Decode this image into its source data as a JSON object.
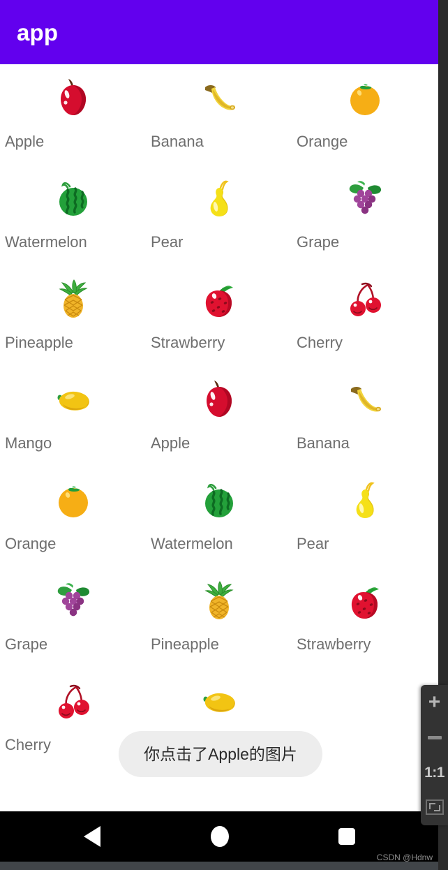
{
  "appbar": {
    "title": "app",
    "background_color": "#6200EE",
    "title_color": "#FFFFFF"
  },
  "grid": {
    "columns": 3,
    "label_color": "#6E6E6E",
    "rows": [
      [
        {
          "label": "Apple",
          "icon": "apple-icon"
        },
        {
          "label": "Banana",
          "icon": "banana-icon"
        },
        {
          "label": "Orange",
          "icon": "orange-icon"
        }
      ],
      [
        {
          "label": "Watermelon",
          "icon": "watermelon-icon"
        },
        {
          "label": "Pear",
          "icon": "pear-icon"
        },
        {
          "label": "Grape",
          "icon": "grape-icon"
        }
      ],
      [
        {
          "label": "Pineapple",
          "icon": "pineapple-icon"
        },
        {
          "label": "Strawberry",
          "icon": "strawberry-icon"
        },
        {
          "label": "Cherry",
          "icon": "cherry-icon"
        }
      ],
      [
        {
          "label": "Mango",
          "icon": "mango-icon"
        },
        {
          "label": "Apple",
          "icon": "apple-icon"
        },
        {
          "label": "Banana",
          "icon": "banana-icon"
        }
      ],
      [
        {
          "label": "Orange",
          "icon": "orange-icon"
        },
        {
          "label": "Watermelon",
          "icon": "watermelon-icon"
        },
        {
          "label": "Pear",
          "icon": "pear-icon"
        }
      ],
      [
        {
          "label": "Grape",
          "icon": "grape-icon"
        },
        {
          "label": "Pineapple",
          "icon": "pineapple-icon"
        },
        {
          "label": "Strawberry",
          "icon": "strawberry-icon"
        }
      ],
      [
        {
          "label": "Cherry",
          "icon": "cherry-icon"
        },
        {
          "label": "Mango",
          "icon": "mango-icon"
        },
        {
          "label": "",
          "icon": ""
        }
      ]
    ]
  },
  "toast": {
    "message": "你点击了Apple的图片",
    "background_color": "#EDEDED",
    "text_color": "#2B2B2B"
  },
  "navbar": {
    "background_color": "#000000",
    "buttons": [
      {
        "name": "back-button",
        "icon": "triangle-back-icon"
      },
      {
        "name": "home-button",
        "icon": "circle-home-icon"
      },
      {
        "name": "recents-button",
        "icon": "square-recents-icon"
      }
    ]
  },
  "zoom_toolbar": {
    "background_color": "#333333",
    "buttons": [
      {
        "name": "zoom-in-button",
        "label": "+",
        "icon": "plus-icon"
      },
      {
        "name": "zoom-out-button",
        "label": "",
        "icon": "minus-icon"
      },
      {
        "name": "zoom-reset-button",
        "label": "1:1",
        "icon": "one-to-one-icon"
      },
      {
        "name": "zoom-fit-button",
        "label": "",
        "icon": "fit-screen-icon"
      }
    ]
  },
  "watermark": {
    "text": "CSDN @Hdnw"
  }
}
